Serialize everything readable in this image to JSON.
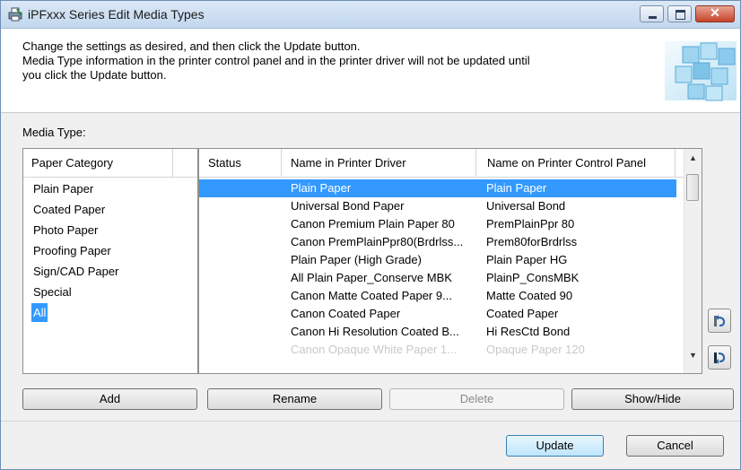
{
  "window": {
    "title": "iPFxxx Series Edit Media Types",
    "buttons": {
      "minimize_icon": "minimize-icon",
      "maximize_icon": "maximize-icon",
      "close_glyph": "✕"
    }
  },
  "header": {
    "lines": [
      "Change the settings as desired, and then click the Update button.",
      "Media Type information in the printer control panel and in the printer driver will not be updated until",
      "you click the Update button."
    ]
  },
  "media_type_label": "Media Type:",
  "category_panel": {
    "header": "Paper Category",
    "items": [
      {
        "label": "Plain Paper"
      },
      {
        "label": "Coated Paper"
      },
      {
        "label": "Photo Paper"
      },
      {
        "label": "Proofing Paper"
      },
      {
        "label": "Sign/CAD Paper"
      },
      {
        "label": "Special"
      },
      {
        "label": "All",
        "selected": true
      }
    ]
  },
  "media_list": {
    "columns": [
      "Status",
      "Name in Printer Driver",
      "Name on Printer Control Panel"
    ],
    "rows": [
      {
        "status": "",
        "driver": "Plain Paper",
        "panel": "Plain Paper",
        "selected": true
      },
      {
        "status": "",
        "driver": "Universal Bond Paper",
        "panel": "Universal Bond"
      },
      {
        "status": "",
        "driver": "Canon Premium Plain Paper 80",
        "panel": "PremPlainPpr 80"
      },
      {
        "status": "",
        "driver": "Canon PremPlainPpr80(Brdrlss...",
        "panel": "Prem80forBrdrlss"
      },
      {
        "status": "",
        "driver": "Plain Paper (High Grade)",
        "panel": "Plain Paper HG"
      },
      {
        "status": "",
        "driver": "All Plain Paper_Conserve MBK",
        "panel": "PlainP_ConsMBK"
      },
      {
        "status": "",
        "driver": "Canon Matte Coated Paper 9...",
        "panel": "Matte Coated 90"
      },
      {
        "status": "",
        "driver": "Canon Coated Paper",
        "panel": "Coated Paper"
      },
      {
        "status": "",
        "driver": "Canon Hi Resolution Coated B...",
        "panel": "Hi ResCtd Bond"
      },
      {
        "status": "",
        "driver": "Canon Opaque White Paper 1...",
        "panel": "Opaque Paper 120",
        "disabled": true
      }
    ]
  },
  "side_buttons": {
    "move_up_icon": "move-up-icon",
    "move_down_icon": "move-down-icon"
  },
  "action_buttons": {
    "add": "Add",
    "rename": "Rename",
    "delete": "Delete",
    "show_hide": "Show/Hide"
  },
  "footer_buttons": {
    "update": "Update",
    "cancel": "Cancel"
  },
  "colors": {
    "selection": "#3399ff",
    "disabled_text": "#c9c9c9"
  }
}
